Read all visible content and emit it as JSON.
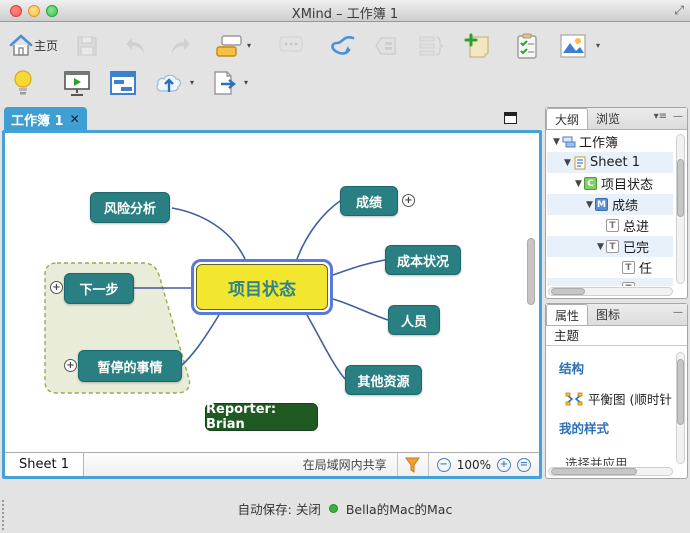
{
  "window": {
    "title": "XMind – 工作簿 1"
  },
  "toolbar": {
    "home_label": "主页"
  },
  "icons": {
    "close_glyph": "✕",
    "tree_arrow": "▼",
    "dropdown_arrow": "▾",
    "view_menu": "▾≡",
    "minimize": "—",
    "fullscreen": "⤢",
    "plus": "+",
    "zoom_out": "−",
    "zoom_in": "+",
    "zoom_fit": "="
  },
  "editor": {
    "doc_tab_label": "工作簿 1",
    "sheet_tab_label": "Sheet 1",
    "share_label": "在局域网内共享",
    "zoom_level": "100%"
  },
  "mindmap": {
    "central_topic": "项目状态",
    "topics": {
      "risk": "风险分析",
      "achievement": "成绩",
      "cost": "成本状况",
      "people": "人员",
      "other_resources": "其他资源",
      "next_step": "下一步",
      "paused": "暂停的事情"
    },
    "legend": "Reporter: Brian"
  },
  "outline_panel": {
    "tab_outline": "大纲",
    "tab_browse": "浏览",
    "badges": {
      "central": "C",
      "main": "M",
      "topic": "T"
    },
    "rows": [
      {
        "label": "工作簿"
      },
      {
        "label": "Sheet 1"
      },
      {
        "label": "项目状态"
      },
      {
        "label": "成绩"
      },
      {
        "label": "总进"
      },
      {
        "label": "已完"
      },
      {
        "label": "任"
      },
      {
        "label": ""
      }
    ]
  },
  "properties_panel": {
    "tab_properties": "属性",
    "tab_icons": "图标",
    "section_theme": "主题",
    "section_structure": "结构",
    "structure_value": "平衡图 (顺时针",
    "section_my_styles": "我的样式",
    "my_styles_action": "选择并应用"
  },
  "statusbar": {
    "autosave": "自动保存: 关闭",
    "machine": "Bella的Mac的Mac"
  },
  "colors": {
    "accent_blue": "#45a1d8",
    "topic_teal": "#2a7f83",
    "central_yellow": "#f2e62e",
    "selection_blue": "#5b79d6",
    "boundary_fill": "#e9ecd8",
    "boundary_border": "#9aa94e",
    "legend_green": "#1e5a22",
    "line_navy": "#3f5e9e",
    "status_green": "#3db03d",
    "funnel_orange": "#f0a030"
  }
}
